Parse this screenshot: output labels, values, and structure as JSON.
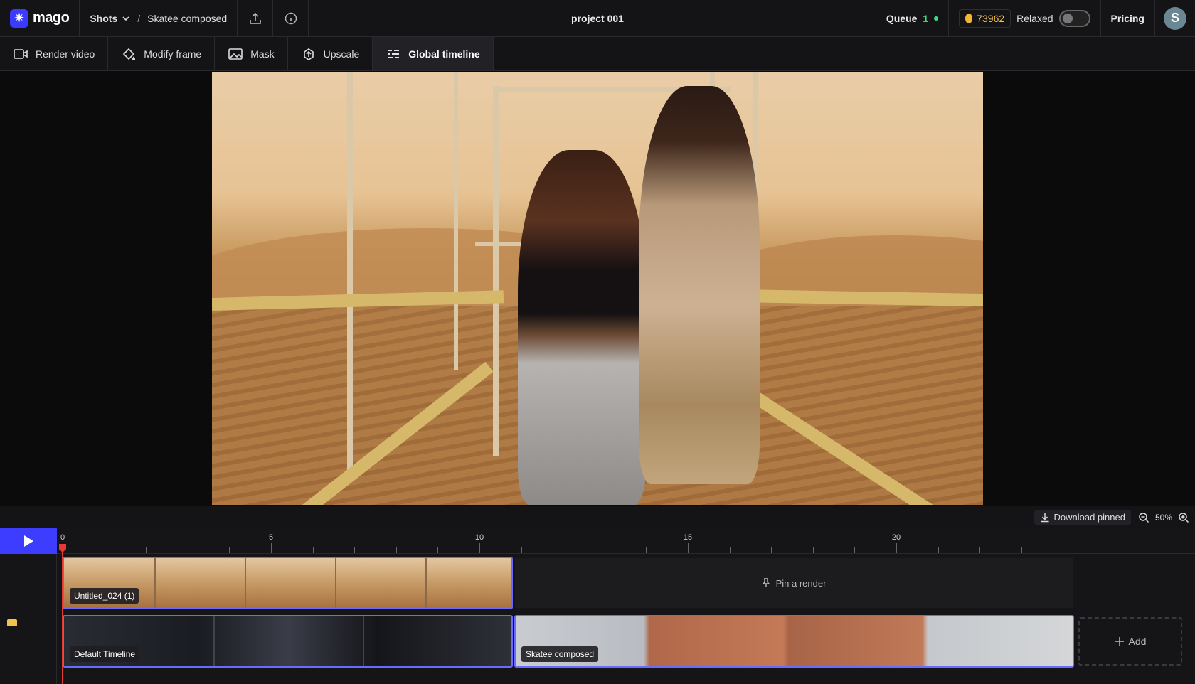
{
  "app": {
    "brand": "mago",
    "breadcrumb": {
      "section": "Shots",
      "current": "Skatee composed"
    },
    "project_title": "project 001"
  },
  "header": {
    "queue_label": "Queue",
    "queue_count": "1",
    "credits": "73962",
    "mode_label": "Relaxed",
    "mode_enabled": false,
    "pricing_label": "Pricing",
    "avatar_initial": "S"
  },
  "toolbar": {
    "items": [
      {
        "label": "Render video",
        "icon": "video-camera-icon",
        "active": false
      },
      {
        "label": "Modify frame",
        "icon": "paint-bucket-icon",
        "active": false
      },
      {
        "label": "Mask",
        "icon": "mask-icon",
        "active": false
      },
      {
        "label": "Upscale",
        "icon": "upscale-icon",
        "active": false
      },
      {
        "label": "Global timeline",
        "icon": "timeline-icon",
        "active": true
      }
    ]
  },
  "timeline_controls": {
    "download_label": "Download pinned",
    "zoom_level": "50%"
  },
  "timeline": {
    "ruler_labels": [
      "0",
      "5",
      "10",
      "15",
      "20"
    ],
    "track1": {
      "clip_label": "Untitled_024 (1)",
      "pin_label": "Pin a render"
    },
    "track2": {
      "clips": [
        {
          "label": "Default Timeline"
        },
        {
          "label": "Skatee composed"
        }
      ],
      "add_label": "Add"
    }
  },
  "colors": {
    "accent": "#3d3dff",
    "clip_border": "#6a6aff",
    "playhead": "#e53935",
    "queue_green": "#3ddc84",
    "credit_gold": "#f2c14e"
  }
}
